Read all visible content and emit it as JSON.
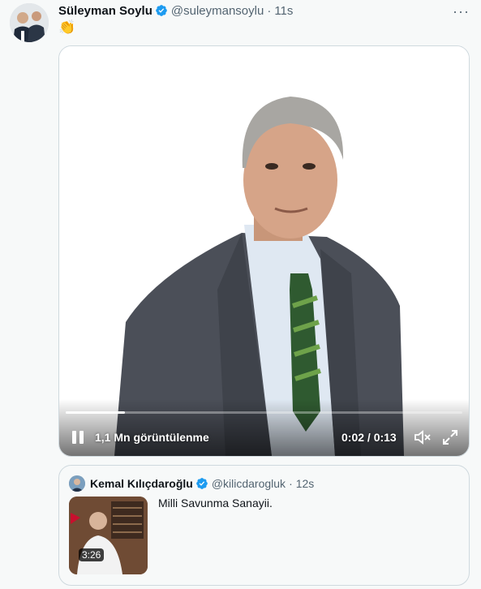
{
  "tweet": {
    "author_name": "Süleyman Soylu",
    "handle": "@suleymansoylu",
    "separator": "·",
    "time": "11s",
    "more_label": "···",
    "text": "👏"
  },
  "video": {
    "views": "1,1 Mn görüntülenme",
    "time_display": "0:02 / 0:13",
    "progress": 0.15
  },
  "quote": {
    "author_name": "Kemal Kılıçdaroğlu",
    "handle": "@kilicdarogluk",
    "separator": "·",
    "time": "12s",
    "text": "Milli Savunma Sanayii.",
    "duration": "3:26"
  },
  "colors": {
    "verified": "#1d9bf0",
    "text_primary": "#0f1419",
    "text_secondary": "#536471",
    "border": "#cfd9de"
  }
}
